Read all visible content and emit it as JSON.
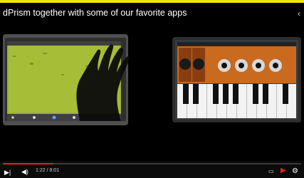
{
  "video": {
    "title": "dPrism together with some of our favorite apps",
    "time_display": "1:22 / 8:01",
    "progress": 0.17,
    "right_edge_glyph": "‹"
  },
  "icons": {
    "play": "next-icon",
    "volume": "volume-icon",
    "captions": "captions-icon",
    "youtube": "youtube-logo",
    "settings": "settings-icon"
  },
  "colors": {
    "accent": "#e0231c",
    "tablet_screen": "#a9bf3a",
    "synth_panel": "#c96a1f"
  }
}
